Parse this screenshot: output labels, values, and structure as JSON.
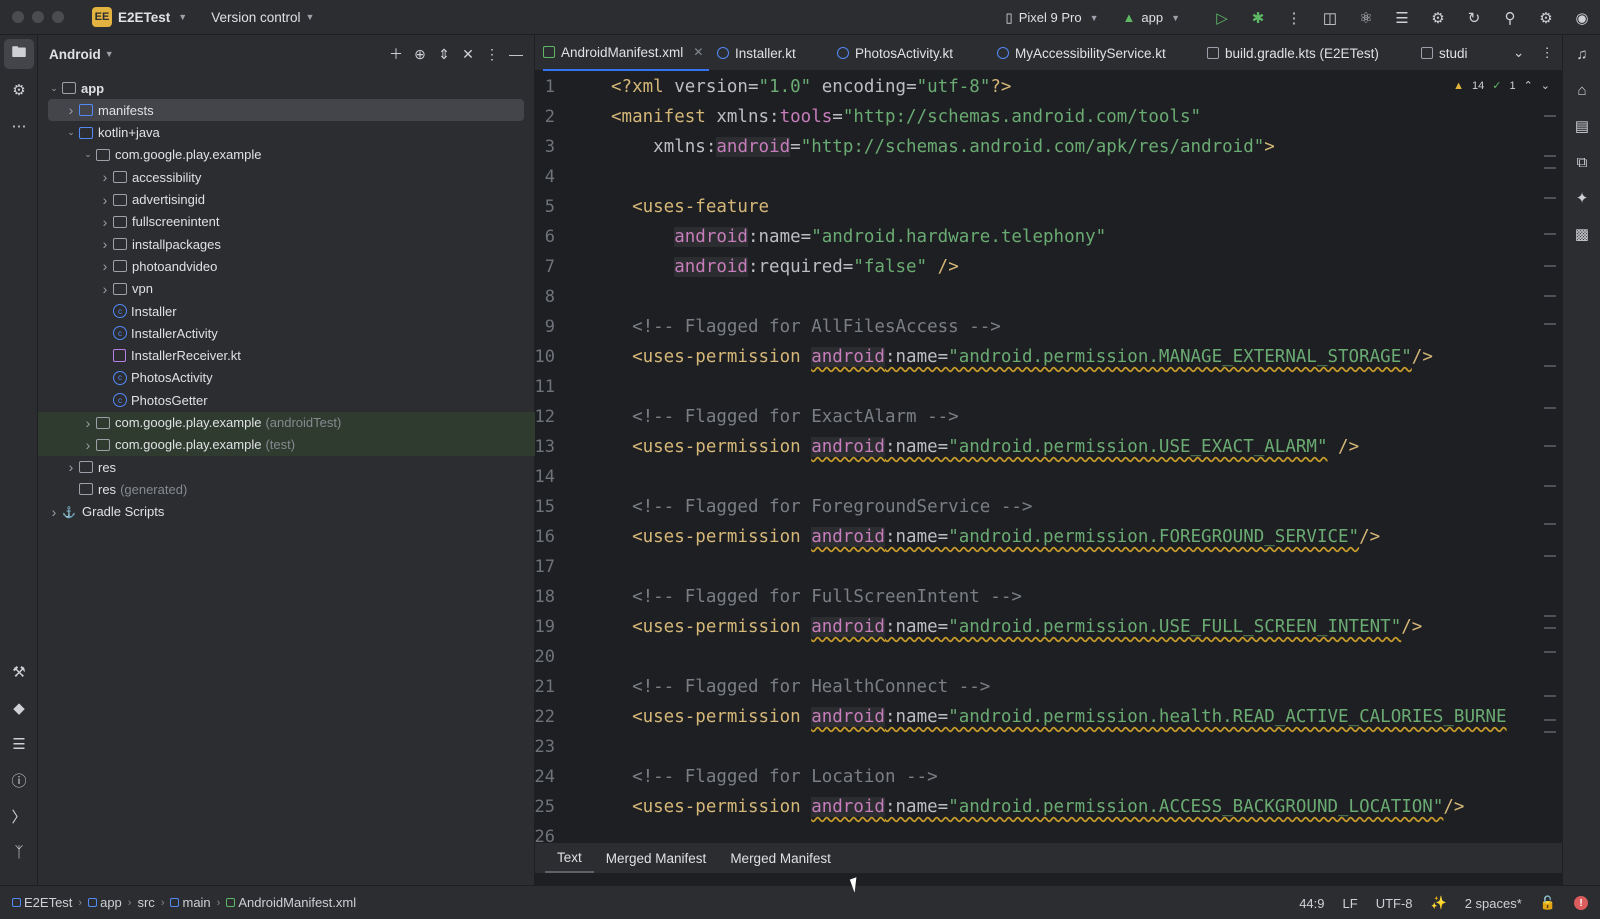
{
  "titlebar": {
    "project_badge": "EE",
    "project_name": "E2ETest",
    "version_control": "Version control",
    "device": "Pixel 9 Pro",
    "run_config": "app"
  },
  "project_panel": {
    "title": "Android",
    "tree": [
      {
        "label": "app",
        "indent": 0,
        "expanded": true,
        "type": "module",
        "bold": true
      },
      {
        "label": "manifests",
        "indent": 1,
        "expanded": false,
        "type": "folder-blue",
        "selected": true
      },
      {
        "label": "kotlin+java",
        "indent": 1,
        "expanded": true,
        "type": "folder-blue"
      },
      {
        "label": "com.google.play.example",
        "indent": 2,
        "expanded": true,
        "type": "package"
      },
      {
        "label": "accessibility",
        "indent": 3,
        "expanded": false,
        "type": "package"
      },
      {
        "label": "advertisingid",
        "indent": 3,
        "expanded": false,
        "type": "package"
      },
      {
        "label": "fullscreenintent",
        "indent": 3,
        "expanded": false,
        "type": "package"
      },
      {
        "label": "installpackages",
        "indent": 3,
        "expanded": false,
        "type": "package"
      },
      {
        "label": "photoandvideo",
        "indent": 3,
        "expanded": false,
        "type": "package"
      },
      {
        "label": "vpn",
        "indent": 3,
        "expanded": false,
        "type": "package"
      },
      {
        "label": "Installer",
        "indent": 3,
        "type": "class"
      },
      {
        "label": "InstallerActivity",
        "indent": 3,
        "type": "class"
      },
      {
        "label": "InstallerReceiver.kt",
        "indent": 3,
        "type": "kotlin"
      },
      {
        "label": "PhotosActivity",
        "indent": 3,
        "type": "class"
      },
      {
        "label": "PhotosGetter",
        "indent": 3,
        "type": "class"
      },
      {
        "label": "com.google.play.example",
        "suffix": "(androidTest)",
        "indent": 2,
        "expanded": false,
        "type": "package",
        "test": true
      },
      {
        "label": "com.google.play.example",
        "suffix": "(test)",
        "indent": 2,
        "expanded": false,
        "type": "package",
        "test": true
      },
      {
        "label": "res",
        "indent": 1,
        "expanded": false,
        "type": "folder"
      },
      {
        "label": "res",
        "suffix": "(generated)",
        "indent": 1,
        "type": "folder"
      },
      {
        "label": "Gradle Scripts",
        "indent": 0,
        "expanded": false,
        "type": "gradle"
      }
    ]
  },
  "editor": {
    "tabs": [
      {
        "label": "AndroidManifest.xml",
        "active": true,
        "icon": "xml"
      },
      {
        "label": "Installer.kt",
        "icon": "class"
      },
      {
        "label": "PhotosActivity.kt",
        "icon": "class"
      },
      {
        "label": "MyAccessibilityService.kt",
        "icon": "class"
      },
      {
        "label": "build.gradle.kts (E2ETest)",
        "icon": "gradle"
      },
      {
        "label": "studi",
        "icon": "text"
      }
    ],
    "inspections": {
      "warnings": "14",
      "weak_warnings": "1"
    },
    "line_numbers": [
      "1",
      "2",
      "3",
      "4",
      "5",
      "6",
      "7",
      "8",
      "9",
      "10",
      "11",
      "12",
      "13",
      "14",
      "15",
      "16",
      "17",
      "18",
      "19",
      "20",
      "21",
      "22",
      "23",
      "24",
      "25",
      "26"
    ],
    "bottom_tabs": [
      "Text",
      "Merged Manifest",
      "Merged Manifest"
    ]
  },
  "statusbar": {
    "breadcrumbs": [
      "E2ETest",
      "app",
      "src",
      "main",
      "AndroidManifest.xml"
    ],
    "position": "44:9",
    "line_sep": "LF",
    "encoding": "UTF-8",
    "indent": "2 spaces*",
    "errors": "!"
  }
}
